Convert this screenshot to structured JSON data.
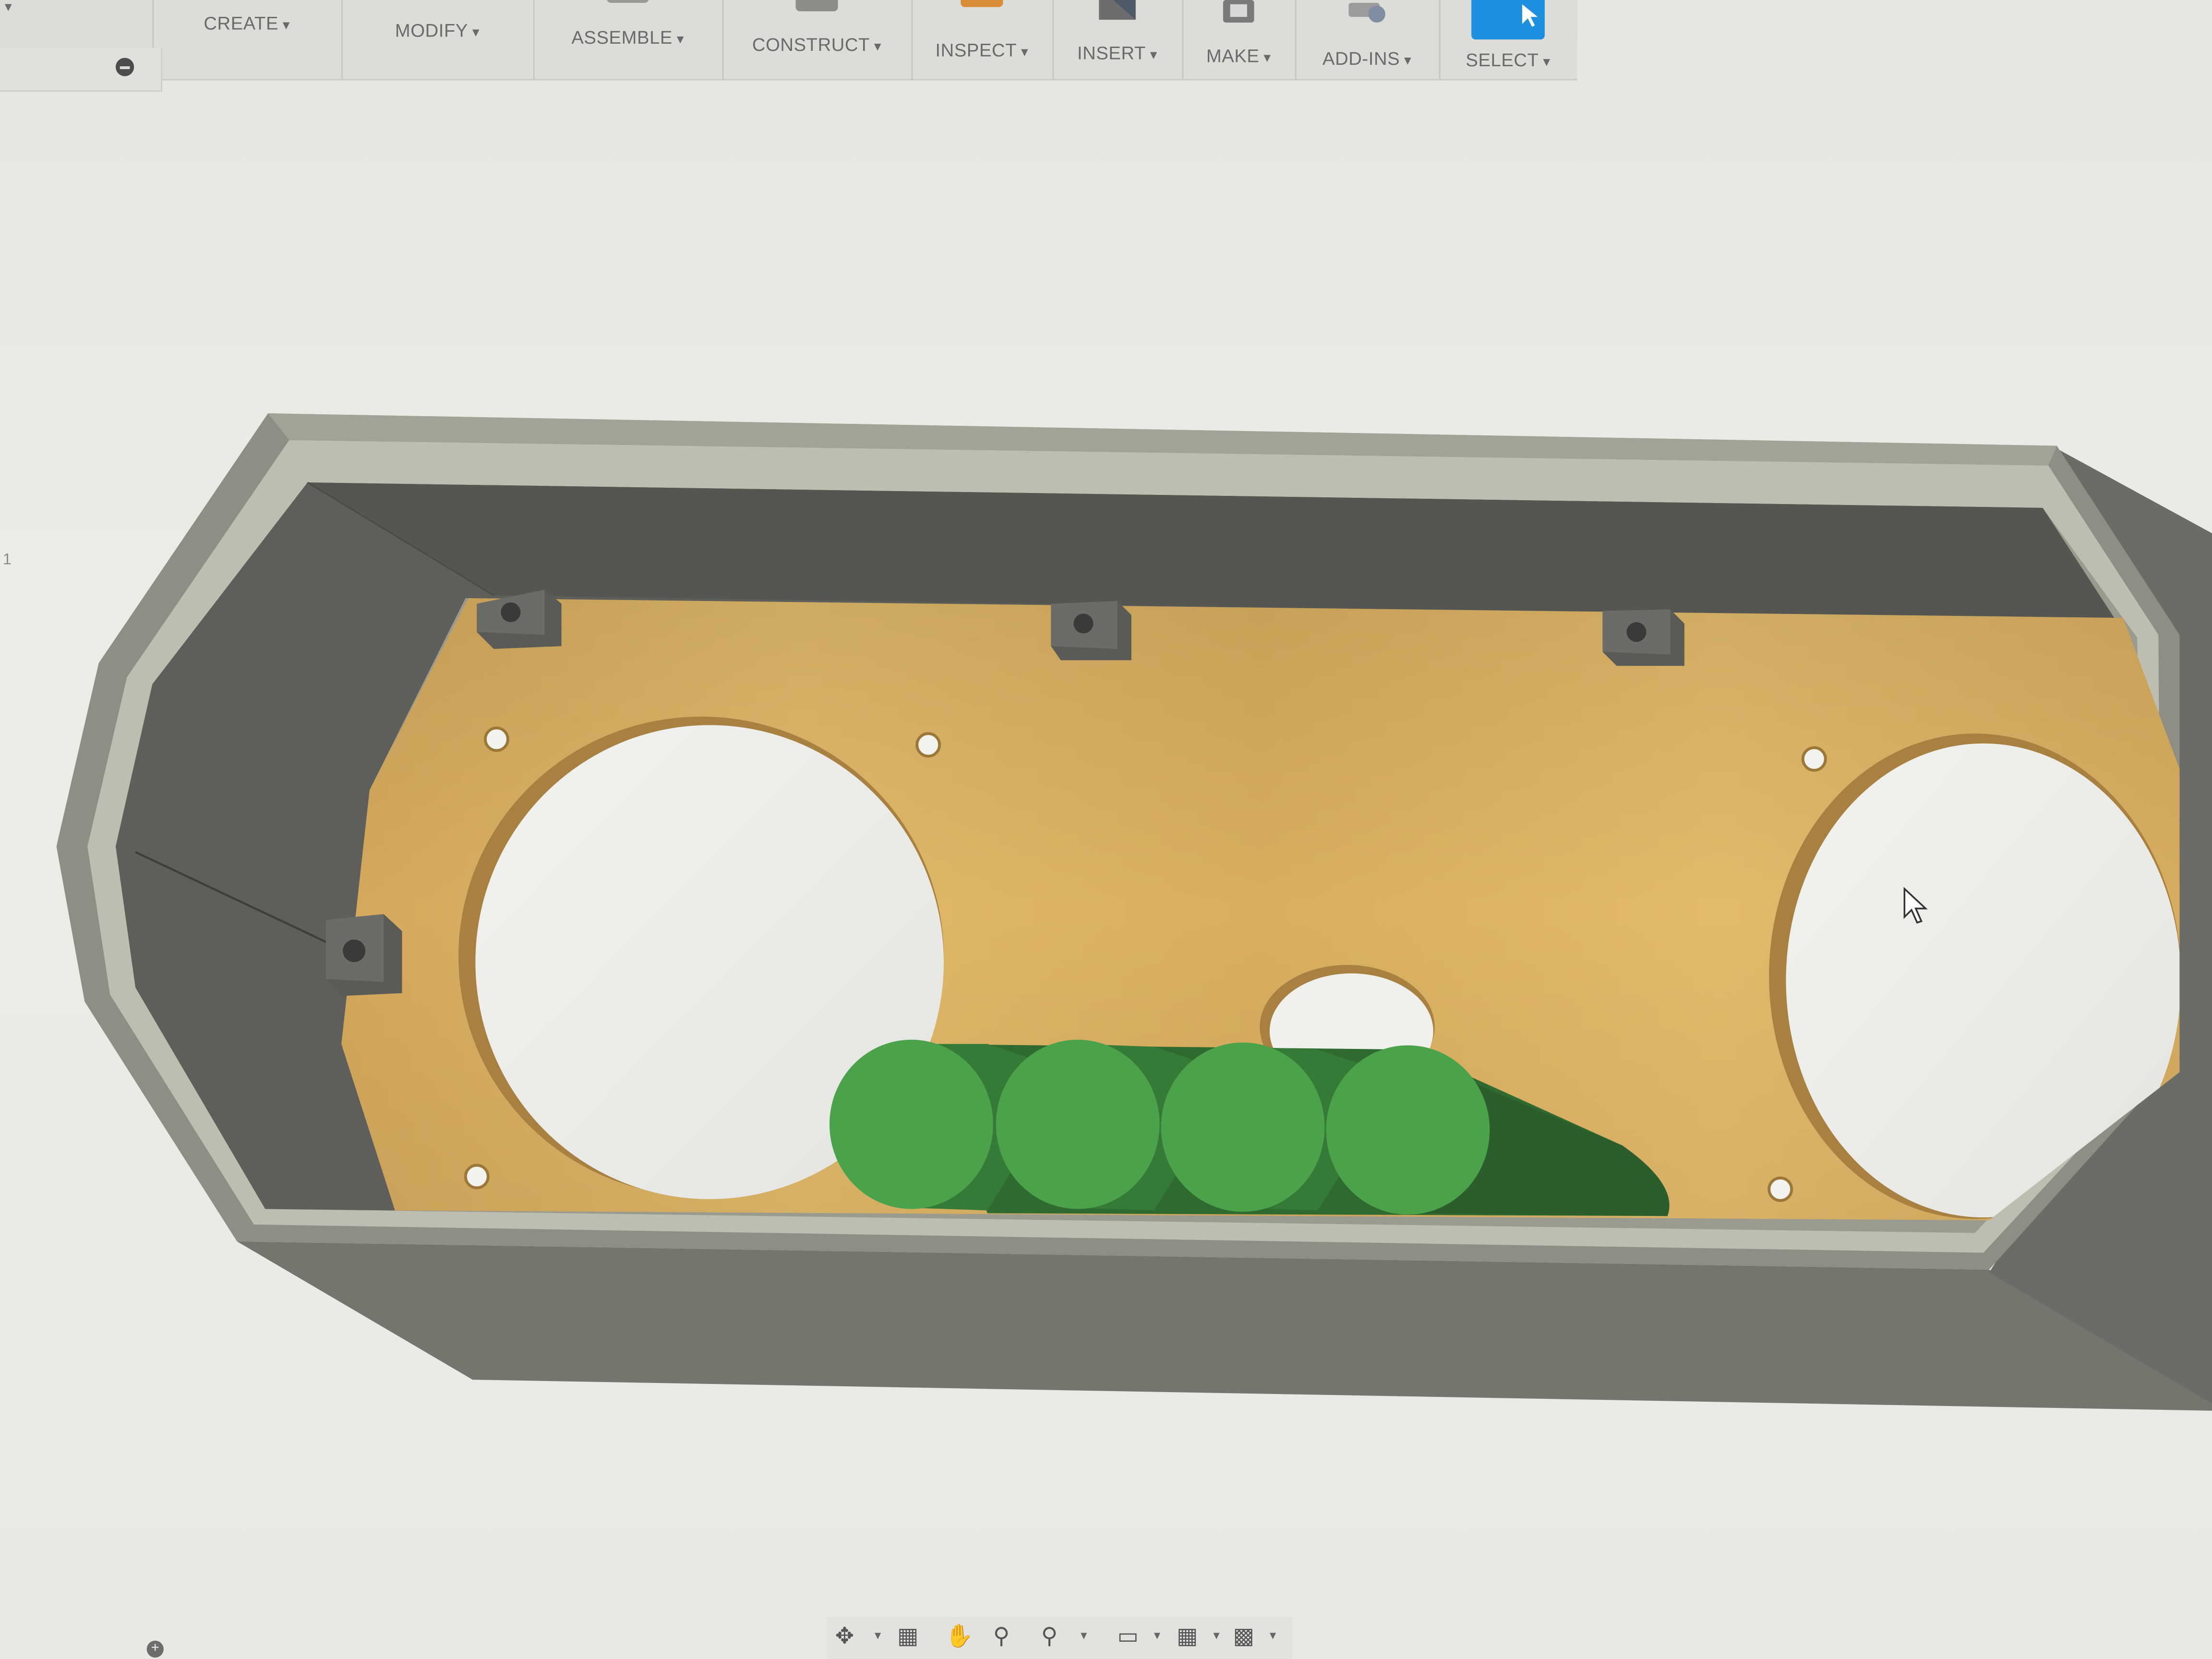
{
  "toolbar": {
    "groups": [
      {
        "label": "CREATE",
        "icon": "create-icon"
      },
      {
        "label": "MODIFY",
        "icon": "modify-icon"
      },
      {
        "label": "ASSEMBLE",
        "icon": "assemble-icon"
      },
      {
        "label": "CONSTRUCT",
        "icon": "construct-icon"
      },
      {
        "label": "INSPECT",
        "icon": "inspect-icon"
      },
      {
        "label": "INSERT",
        "icon": "insert-icon"
      },
      {
        "label": "MAKE",
        "icon": "make-icon"
      },
      {
        "label": "ADD-INS",
        "icon": "add-ins-icon"
      },
      {
        "label": "SELECT",
        "icon": "select-cursor-icon"
      }
    ],
    "select_color": "#1f8fe0"
  },
  "browser": {
    "side_number": "1"
  },
  "viewport": {
    "shell_color": "#8b8b80",
    "board_color": "#d9b165",
    "battery_color": "#4aa24a",
    "background_color": "#ebebe7"
  },
  "navbar": {
    "icons": [
      "orbit-icon",
      "look-at-icon",
      "pan-icon",
      "zoom-icon",
      "fit-icon",
      "display-settings-icon",
      "grid-icon",
      "viewports-icon"
    ]
  }
}
